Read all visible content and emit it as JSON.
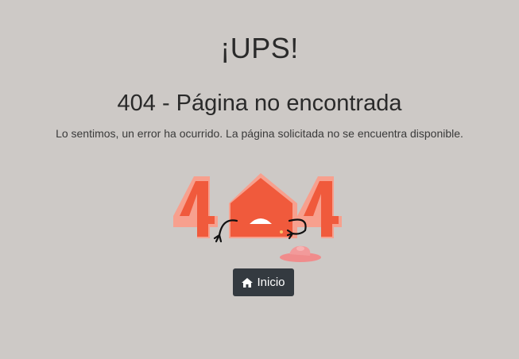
{
  "heading": "¡UPS!",
  "title": "404 - Página no encontrada",
  "message": "Lo sentimos, un error ha ocurrido. La página solicitada no se encuentra disponible.",
  "illustration": {
    "icon": "broken-404-house-illustration",
    "primary_color": "#f05a3c",
    "shadow_color": "#f7a08e"
  },
  "home_button": {
    "label": "Inicio",
    "icon": "home-icon",
    "background": "#343a40"
  }
}
